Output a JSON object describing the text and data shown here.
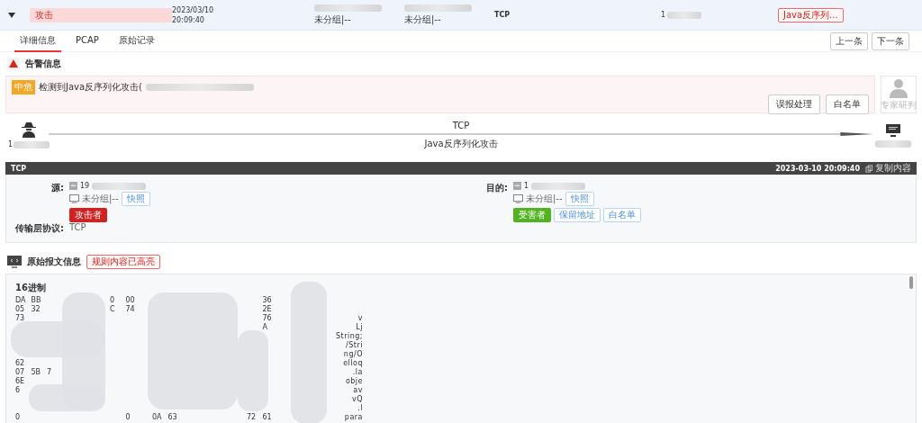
{
  "row": {
    "expanded": true,
    "tag": "攻击",
    "date": "2023/03/10",
    "time": "20:09:40",
    "source_group": "未分组|--",
    "dest_group": "未分组|--",
    "protocol": "TCP",
    "address_prefix": "1",
    "rule_tag": "Java反序列..."
  },
  "tabs": [
    {
      "label": "详细信息",
      "selected": true
    },
    {
      "label": "PCAP",
      "selected": false
    },
    {
      "label": "原始记录",
      "selected": false
    }
  ],
  "nav_buttons": [
    "上一条",
    "下一条"
  ],
  "alert": {
    "title": "告警信息",
    "severity": "中危",
    "message": "检测到Java反序列化攻击(",
    "buttons": [
      "误报处理",
      "白名单"
    ],
    "expert": {
      "label": "专家研判",
      "disabled": true
    }
  },
  "flow": {
    "protocol": "TCP",
    "attack": "Java反序列化攻击",
    "source_prefix": "1"
  },
  "session": {
    "protocol": "TCP",
    "time": "2023-03-10 20:09:40",
    "copy": "复制内容",
    "transport_label": "传输层协议:",
    "transport": "TCP",
    "endpoints": [
      {
        "label": "源:",
        "ip_prefix": "19",
        "group": "未分组|--",
        "snapshot": "快照",
        "tags": [
          {
            "text": "攻击者",
            "kind": "attacker"
          }
        ]
      },
      {
        "label": "目的:",
        "ip_prefix": "1",
        "group": "未分组|--",
        "snapshot": "快照",
        "tags": [
          {
            "text": "受害者",
            "kind": "victim"
          },
          {
            "text": "保留地址",
            "kind": "link"
          },
          {
            "text": "白名单",
            "kind": "link"
          }
        ]
      }
    ]
  },
  "raw": {
    "title": "原始报文信息",
    "badge": "规则内容已高亮",
    "subtitle": "16进制",
    "rows": [
      {
        "first_start": [
          "DA",
          "BB"
        ],
        "first_end": [
          "0",
          "00"
        ],
        "second_end": [
          "36"
        ]
      },
      {
        "first_start": [
          "05",
          "32"
        ],
        "first_end": [
          "C",
          "74"
        ],
        "second_end": [
          "2E"
        ]
      },
      {
        "first_start": [
          "73"
        ],
        "second_end": [
          "76"
        ],
        "ascii": "v"
      },
      {
        "second_end": [
          "A"
        ],
        "ascii": "Lj"
      },
      {
        "ascii": "String;"
      },
      {
        "ascii": "/Stri"
      },
      {
        "ascii": "ng/O"
      },
      {
        "first_start": [
          "62"
        ],
        "ascii": "elloq"
      },
      {
        "first_start": [
          "07",
          "5B",
          "7"
        ],
        "ascii": ".la"
      },
      {
        "first_start": [
          "6E"
        ],
        "ascii": "obje"
      },
      {
        "first_start": [
          "6"
        ],
        "ascii": "av"
      },
      {
        "ascii": "vQ"
      },
      {
        "ascii": ".l"
      },
      {
        "first_start": [
          "0"
        ],
        "first_end": [
          "0"
        ],
        "second_start": [
          "0A",
          "63"
        ],
        "second_end": [
          "72",
          "61"
        ],
        "ascii": "para"
      }
    ]
  }
}
